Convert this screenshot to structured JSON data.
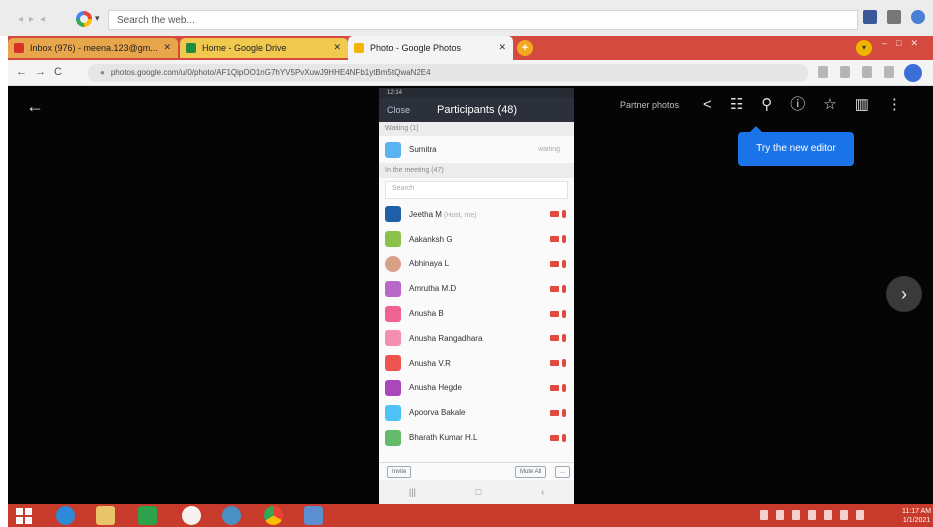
{
  "outer_window": {
    "search_placeholder": "Search the web..."
  },
  "tabs": [
    {
      "label": "Inbox (976) - meena.123@gm...",
      "icon_color": "#d93025",
      "active": false
    },
    {
      "label": "Home - Google Drive",
      "icon_color": "#1e8e3e",
      "active": false
    },
    {
      "label": "Photo - Google Photos",
      "icon_color": "#f4b400",
      "active": true
    }
  ],
  "address_bar": {
    "url": "photos.google.com/u/0/photo/AF1QipOO1nG7hYV5PvXuwJ9HHE4NFb1ytBm5tQwaN2E4"
  },
  "viewer": {
    "toolbar_label": "Partner photos",
    "toolbar_icons": [
      "share-icon",
      "edit-icon",
      "zoom-icon",
      "info-icon",
      "star-icon",
      "delete-icon",
      "more-icon"
    ],
    "tooltip": "Try the new editor",
    "next_symbol": "›",
    "back_symbol": "←"
  },
  "phone": {
    "status_left": "12:14",
    "close_label": "Close",
    "title": "Participants (48)",
    "waiting_label": "Waiting (1)",
    "waiting_person": {
      "name": "Sumitra",
      "status": "waiting",
      "color": "#5ab4ef"
    },
    "in_meeting_label": "In the meeting (47)",
    "search_placeholder": "Search",
    "participants": [
      {
        "name": "Jeetha M",
        "tag": "(Host, me)",
        "color": "#1f5fa8"
      },
      {
        "name": "Aakanksh G",
        "tag": "",
        "color": "#8bc34a"
      },
      {
        "name": "Abhinaya L",
        "tag": "",
        "color": "#d9a089"
      },
      {
        "name": "Amrutha M.D",
        "tag": "",
        "color": "#ba68c8"
      },
      {
        "name": "Anusha B",
        "tag": "",
        "color": "#f06292"
      },
      {
        "name": "Anusha Rangadhara",
        "tag": "",
        "color": "#f48fb1"
      },
      {
        "name": "Anusha V.R",
        "tag": "",
        "color": "#ef5350"
      },
      {
        "name": "Anusha Hegde",
        "tag": "",
        "color": "#ab47bc"
      },
      {
        "name": "Apoorva Bakale",
        "tag": "",
        "color": "#4fc3f7"
      },
      {
        "name": "Bharath Kumar H.L",
        "tag": "",
        "color": "#66bb6a"
      }
    ],
    "footer_left": "Invite",
    "footer_right": "Mute All",
    "footer_more": "..."
  },
  "taskbar": {
    "apps": [
      {
        "name": "ie-icon",
        "color": "#2d8ad8"
      },
      {
        "name": "file-explorer-icon",
        "color": "#e9c46a"
      },
      {
        "name": "store-icon",
        "color": "#2ca24a"
      },
      {
        "name": "cloud-icon",
        "color": "#f6f2f0"
      },
      {
        "name": "settings-icon",
        "color": "#4a90c2"
      },
      {
        "name": "chrome-icon",
        "color": "#e8e8e8"
      },
      {
        "name": "photos-icon",
        "color": "#5b8fd0"
      }
    ],
    "time": "11:17 AM",
    "date": "1/1/2021"
  },
  "colors": {
    "tabstrip": "#d44a3e",
    "viewer_bg": "#050505",
    "tooltip": "#1a73e8",
    "taskbar": "#c83a2c"
  }
}
